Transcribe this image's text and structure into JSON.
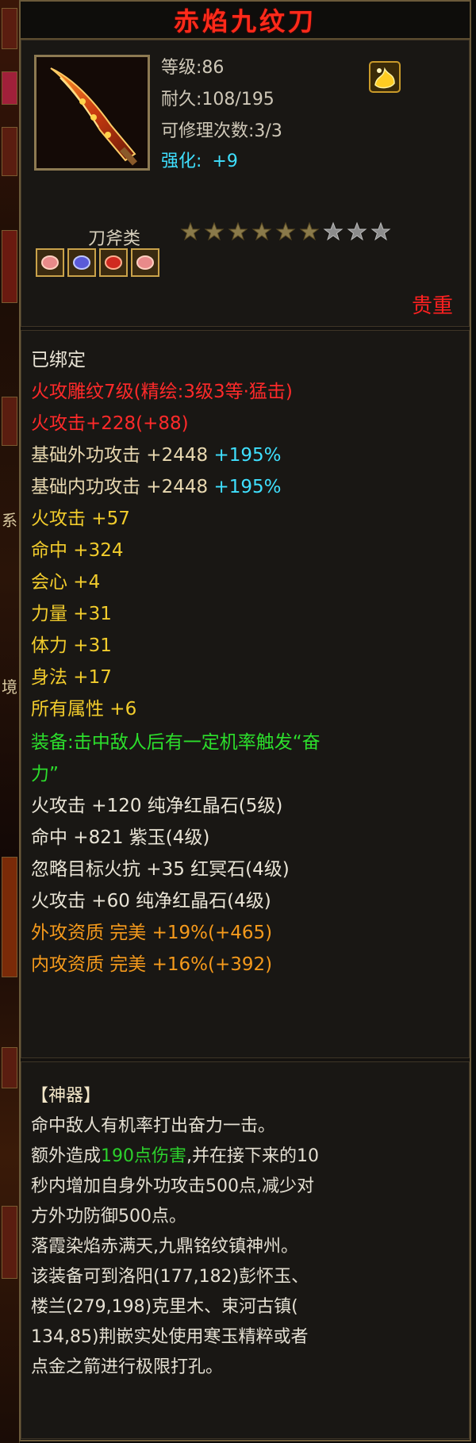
{
  "item": {
    "name": "赤焰九纹刀",
    "level": "等级:86",
    "durability": "耐久:108/195",
    "repair": "可修理次数:3/3",
    "enhance_label": "强化:",
    "enhance_value": "+9",
    "category": "刀斧类",
    "stars_filled": 6,
    "stars_total": 9,
    "rarity": "贵重",
    "gems": [
      "pink-gem-icon",
      "blue-gem-icon",
      "red-gem-icon",
      "pink-gem-icon"
    ]
  },
  "attributes": {
    "bound": "已绑定",
    "engrave": "火攻雕纹7级(精绘:3级3等·猛击)",
    "fire_attack_main": "火攻击+228(+88)",
    "base_ext_label": "基础外功攻击 +2448 ",
    "base_ext_pct": "+195%",
    "base_int_label": "基础内功攻击 +2448 ",
    "base_int_pct": "+195%",
    "stats": [
      "火攻击 +57",
      "命中 +324",
      "会心 +4",
      "力量 +31",
      "体力 +31",
      "身法 +17",
      "所有属性 +6"
    ],
    "equip_line1": "装备:击中敌人后有一定机率触发“奋",
    "equip_line2": "力”",
    "sockets": [
      "火攻击 +120 纯净红晶石(5级)",
      "命中 +821 紫玉(4级)",
      "忽略目标火抗 +35 红冥石(4级)",
      "火攻击 +60 纯净红晶石(4级)"
    ],
    "quality": [
      "外攻资质  完美 +19%(+465)",
      "内攻资质  完美 +16%(+392)"
    ]
  },
  "description": {
    "header": "【神器】",
    "l1": "命中敌人有机率打出奋力一击。",
    "l2a": "额外造成",
    "l2b": "190点伤害",
    "l2c": ",并在接下来的10",
    "l3": "秒内增加自身外功攻击500点,减少对",
    "l4": "方外功防御500点。",
    "l5": "落霞染焰赤满天,九鼎铭纹镇神州。",
    "l6": "该装备可到洛阳(177,182)彭怀玉、",
    "l7": "楼兰(279,198)克里木、束河古镇(",
    "l8": "134,85)荆嵌实处使用寒玉精粹或者",
    "l9": "点金之箭进行极限打孔。"
  },
  "colors": {
    "title": "#ff2a1a",
    "cyan": "#3fe0ff",
    "yellow": "#f2cc2c",
    "green": "#2cdf2c",
    "orange": "#f59a1c",
    "red": "#ff2a2a"
  }
}
